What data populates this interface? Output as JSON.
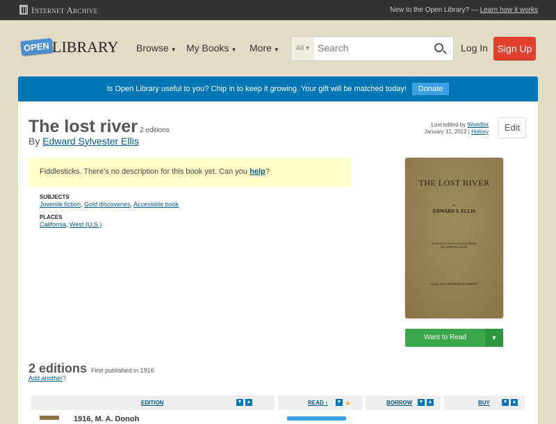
{
  "topbar": {
    "brand": "Internet Archive",
    "new_text": "New to the Open Library? —",
    "learn_link": "Learn how it works"
  },
  "header": {
    "logo_open": "OPEN",
    "logo_library": "LIBRARY",
    "nav": [
      "Browse",
      "My Books",
      "More"
    ],
    "search_scope": "All",
    "search_placeholder": "Search",
    "login": "Log In",
    "signup": "Sign Up"
  },
  "banner": {
    "text": "Is Open Library useful to you? Chip in to keep it growing. Your gift will be matched today!",
    "donate": "Donate"
  },
  "book": {
    "title": "The lost river",
    "editions_count": "2 editions",
    "by": "By",
    "author": "Edward Sylvester Ellis",
    "last_edited_by": "Last edited by",
    "editor": "WorkBot",
    "date": "January 11, 2012 |",
    "history": "History",
    "edit": "Edit",
    "desc_text": "Fiddlesticks. There's no description for this book yet. Can you",
    "desc_link": "help",
    "desc_end": "?",
    "subjects_label": "SUBJECTS",
    "subjects": [
      "Juvenile fiction",
      "Gold discoveries",
      "Accessible book"
    ],
    "places_label": "PLACES",
    "places": [
      "California",
      "West (U.S.)"
    ],
    "cover": {
      "title": "THE LOST RIVER",
      "by": "BY",
      "author": "EDWARD S. ELLIS",
      "sub": "WITH FULL-PAGE ILLUSTRATIONS BY GORDON GRANT",
      "publisher": "Chicago M. A. DONOHUE & COMPANY"
    },
    "want_to_read": "Want to Read"
  },
  "editions": {
    "heading": "2 editions",
    "first_published": "First published in 1916",
    "add_another": "Add another",
    "q": "?",
    "columns": [
      "EDITION",
      "READ ↕",
      "BORROW",
      "BUY"
    ],
    "first_row": "1916, M. A. Donoh"
  },
  "colors": {
    "accent": "#0376b8",
    "signup": "#e2412f",
    "want": "#3ba64b"
  }
}
